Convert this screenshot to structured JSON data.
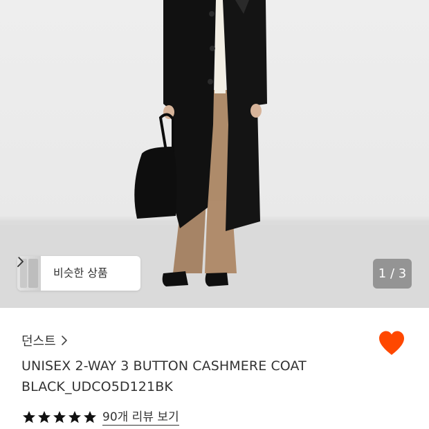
{
  "hero": {
    "similar_products_label": "비슷한 상품",
    "image_counter": "1 / 3"
  },
  "product": {
    "brand": "던스트",
    "title_line1": "UNISEX 2-WAY 3 BUTTON CASHMERE COAT",
    "title_line2": "BLACK_UDCO5D121BK",
    "rating_stars": 5,
    "review_link": "90개 리뷰 보기"
  },
  "colors": {
    "heart": "#ff4800",
    "star": "#111111",
    "badge_bg": "#787878"
  },
  "icons": {
    "favorite": "heart-icon",
    "brand_arrow": "chevron-right-icon",
    "similar_arrow": "chevron-right-icon",
    "rating": "star-icon"
  }
}
